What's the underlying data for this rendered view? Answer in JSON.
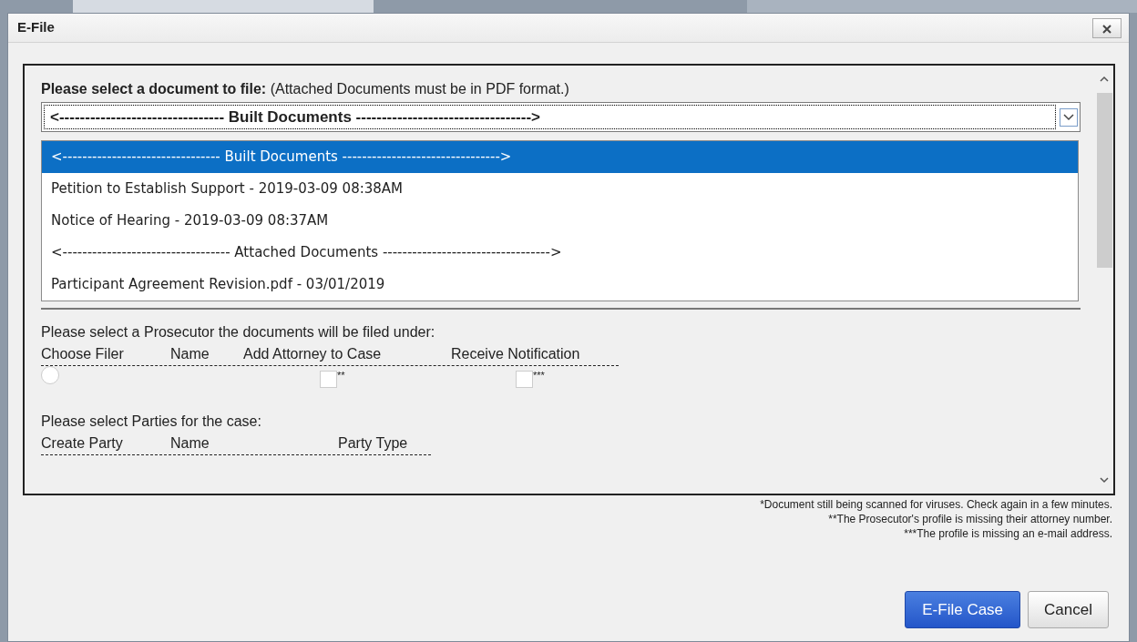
{
  "window": {
    "title": "E-File"
  },
  "document_prompt": {
    "label": "Please select a document to file:",
    "note": "(Attached Documents must be in PDF format.)"
  },
  "document_select": {
    "value": "<-------------------------------- Built Documents ---------------------------------->",
    "expanded": true
  },
  "document_options": [
    {
      "label": "<-------------------------------- Built Documents -------------------------------->",
      "selected": true
    },
    {
      "label": "Petition to Establish Support - 2019-03-09 08:38AM",
      "selected": false
    },
    {
      "label": "Notice of Hearing - 2019-03-09 08:37AM",
      "selected": false
    },
    {
      "label": "<---------------------------------- Attached Documents ---------------------------------->",
      "selected": false
    },
    {
      "label": "Participant Agreement Revision.pdf - 03/01/2019",
      "selected": false
    }
  ],
  "prosecutor_section": {
    "prompt": "Please select a Prosecutor the documents will be filed under:",
    "columns": [
      "Choose Filer",
      "Name",
      "Add Attorney to Case",
      "Receive Notification"
    ],
    "rows": [
      {
        "choose_filer_selected": false,
        "add_attorney_checked": false,
        "add_attorney_note": "**",
        "receive_notification_checked": false,
        "receive_notification_note": "***"
      }
    ]
  },
  "parties_section": {
    "prompt": "Please select Parties for the case:",
    "columns": [
      "Create Party",
      "Name",
      "Party Type"
    ]
  },
  "footnotes": [
    "*Document still being scanned for viruses. Check again in a few minutes.",
    "**The Prosecutor's profile is missing their attorney number.",
    "***The profile is missing an e-mail address."
  ],
  "buttons": [
    {
      "label": "E-File Case",
      "kind": "primary"
    },
    {
      "label": "Cancel",
      "kind": "secondary"
    }
  ]
}
